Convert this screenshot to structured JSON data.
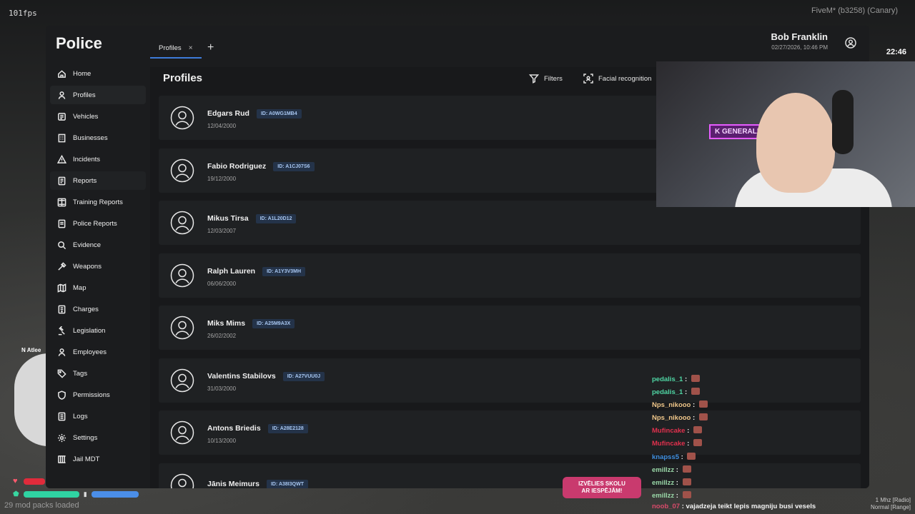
{
  "overlay": {
    "fps": "101fps",
    "fivem": "FiveM* (b3258) (Canary)",
    "clock": "22:46",
    "mods": "29 mod packs loaded",
    "minimap_label": "N  Atlee",
    "radio_line1": "1 Mhz [Radio]",
    "radio_line2": "Normal [Range]"
  },
  "app": {
    "title": "Police"
  },
  "sidebar": {
    "items": [
      {
        "label": "Home",
        "icon": "home-icon"
      },
      {
        "label": "Profiles",
        "icon": "person-icon"
      },
      {
        "label": "Vehicles",
        "icon": "car-icon"
      },
      {
        "label": "Businesses",
        "icon": "building-icon"
      },
      {
        "label": "Incidents",
        "icon": "warning-icon"
      },
      {
        "label": "Reports",
        "icon": "report-icon"
      },
      {
        "label": "Training Reports",
        "icon": "clipboard-icon"
      },
      {
        "label": "Police Reports",
        "icon": "shield-report-icon"
      },
      {
        "label": "Evidence",
        "icon": "magnifier-icon"
      },
      {
        "label": "Weapons",
        "icon": "weapon-icon"
      },
      {
        "label": "Map",
        "icon": "map-icon"
      },
      {
        "label": "Charges",
        "icon": "charges-icon"
      },
      {
        "label": "Legislation",
        "icon": "gavel-icon"
      },
      {
        "label": "Employees",
        "icon": "employees-icon"
      },
      {
        "label": "Tags",
        "icon": "tag-icon"
      },
      {
        "label": "Permissions",
        "icon": "shield-icon"
      },
      {
        "label": "Logs",
        "icon": "logs-icon"
      },
      {
        "label": "Settings",
        "icon": "gear-icon"
      },
      {
        "label": "Jail MDT",
        "icon": "jail-icon"
      }
    ]
  },
  "tabs": [
    {
      "label": "Profiles",
      "close": "×"
    }
  ],
  "tab_add": "+",
  "user": {
    "name": "Bob Franklin",
    "datetime": "02/27/2026, 10:46 PM"
  },
  "main": {
    "title": "Profiles",
    "filters_label": "Filters",
    "facial_label": "Facial recognition"
  },
  "profiles": [
    {
      "name": "Edgars Rud",
      "id": "ID: A0WG1MB4",
      "dob": "12/04/2000"
    },
    {
      "name": "Fabio Rodriguez",
      "id": "ID: A1CJ07S6",
      "dob": "19/12/2000"
    },
    {
      "name": "Mikus Tirsa",
      "id": "ID: A1L20D12",
      "dob": "12/03/2007"
    },
    {
      "name": "Ralph Lauren",
      "id": "ID: A1Y3V3MH",
      "dob": "06/06/2000"
    },
    {
      "name": "Miks Mims",
      "id": "ID: A25M9A3X",
      "dob": "26/02/2002"
    },
    {
      "name": "Valentins Stabilovs",
      "id": "ID: A27VUU0J",
      "dob": "31/03/2000"
    },
    {
      "name": "Antons Briedis",
      "id": "ID: A28E2128",
      "dob": "10/13/2000"
    },
    {
      "name": "Jānis Meimurs",
      "id": "ID: A38I3QWT",
      "dob": ""
    }
  ],
  "webcam": {
    "sign": "K GENERALEK"
  },
  "banner": {
    "line1": "IZVĒLIES SKOLU",
    "line2": "AR IESPĒJĀM!"
  },
  "chat": [
    {
      "user": "pedalis_1",
      "color": "#4fd6a4"
    },
    {
      "user": "pedalis_1",
      "color": "#4fd6a4"
    },
    {
      "user": "Nps_nikooo",
      "color": "#f0c78a"
    },
    {
      "user": "Nps_nikooo",
      "color": "#f0c78a"
    },
    {
      "user": "Mufincake",
      "color": "#e0304d"
    },
    {
      "user": "Mufincake",
      "color": "#e0304d"
    },
    {
      "user": "knapss5",
      "color": "#3f8fe0"
    },
    {
      "user": "emillzz",
      "color": "#9ad8a8"
    },
    {
      "user": "emillzz",
      "color": "#9ad8a8"
    },
    {
      "user": "emillzz",
      "color": "#9ad8a8"
    }
  ],
  "chat_last": {
    "user": "noob_07",
    "color": "#d94a6a",
    "text": "vajadzeja teikt lepis magniju busi vesels"
  },
  "colors": {
    "accent": "#3d7bd9",
    "id_badge_bg": "#243349",
    "id_badge_text": "#a7c6f0"
  }
}
